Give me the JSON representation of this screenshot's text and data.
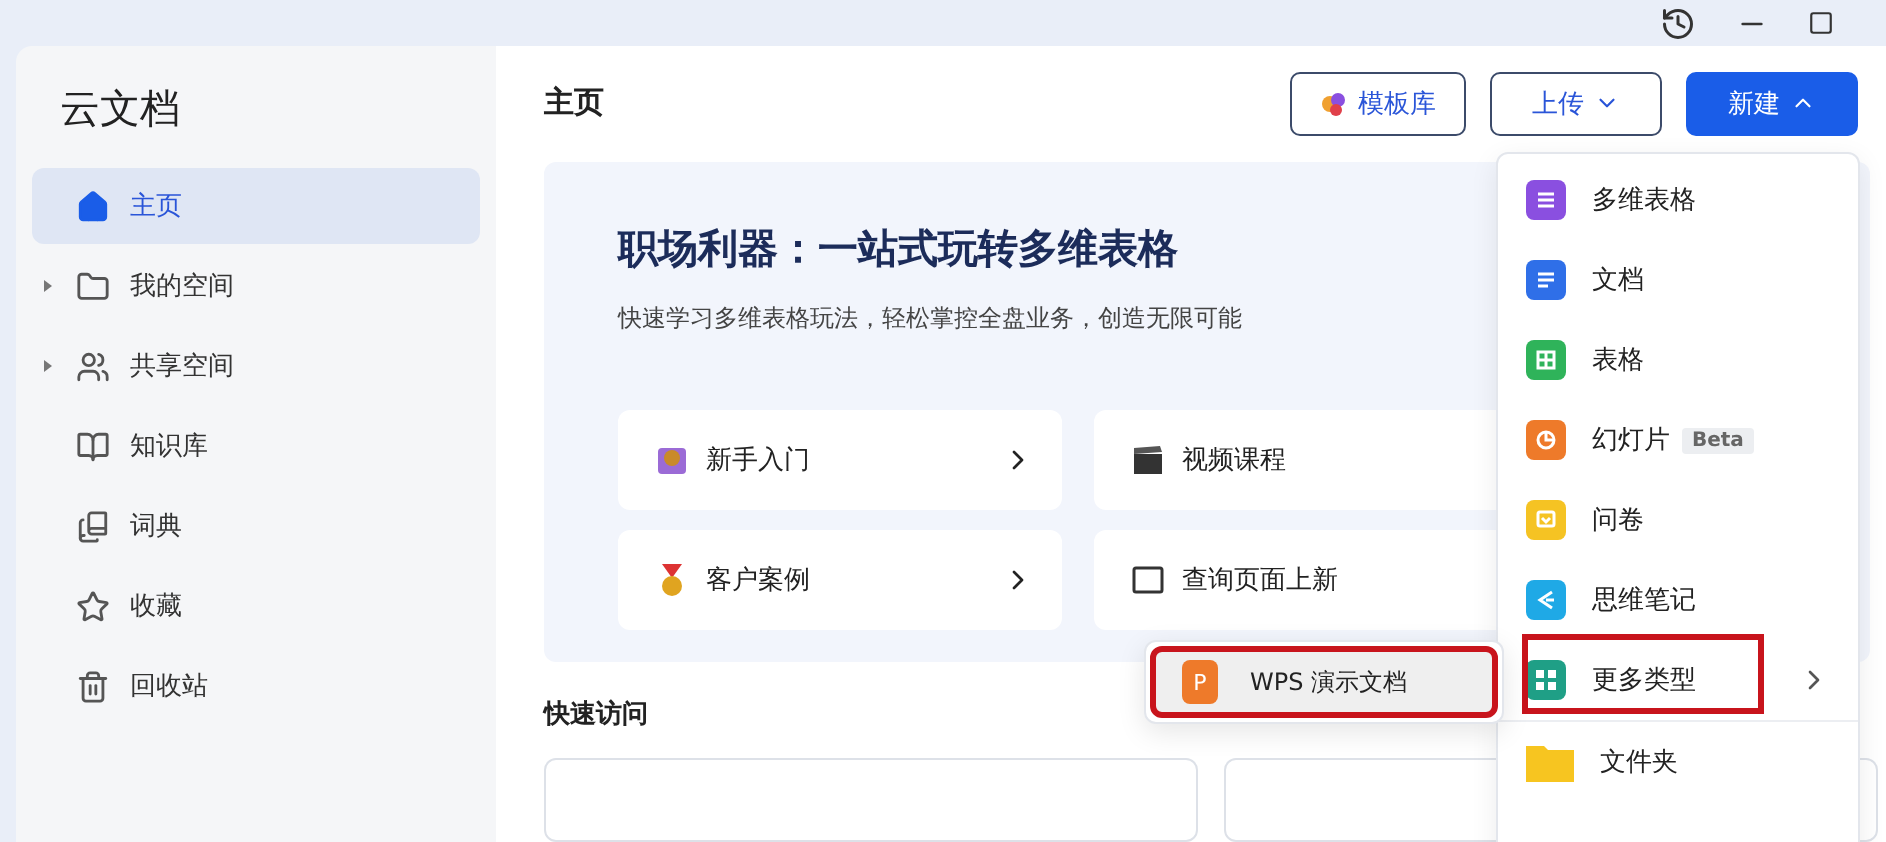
{
  "sidebar": {
    "title": "云文档",
    "items": [
      {
        "label": "主页",
        "kind": "link",
        "selected": true
      },
      {
        "label": "我的空间",
        "kind": "group",
        "selected": false
      },
      {
        "label": "共享空间",
        "kind": "group",
        "selected": false
      },
      {
        "label": "知识库",
        "kind": "link",
        "selected": false
      },
      {
        "label": "词典",
        "kind": "link",
        "selected": false
      },
      {
        "label": "收藏",
        "kind": "link",
        "selected": false
      },
      {
        "label": "回收站",
        "kind": "link",
        "selected": false
      }
    ]
  },
  "header": {
    "title": "主页",
    "buttons": [
      {
        "label": "模板库",
        "kind": "outline"
      },
      {
        "label": "上传",
        "kind": "outline-caret"
      },
      {
        "label": "新建",
        "kind": "primary"
      }
    ]
  },
  "banner": {
    "title": "职场利器：一站式玩转多维表格",
    "subtitle": "快速学习多维表格玩法，轻松掌控全盘业务，创造无限可能",
    "tiles": [
      {
        "label": "新手入门"
      },
      {
        "label": "视频课程"
      },
      {
        "label": "客户案例"
      },
      {
        "label": "查询页面上新"
      }
    ]
  },
  "quick_access": {
    "title": "快速访问"
  },
  "new_menu": {
    "items": [
      {
        "label": "多维表格",
        "color": "#8a4fe0",
        "highlighted": false
      },
      {
        "label": "文档",
        "color": "#2f6fe8",
        "highlighted": false
      },
      {
        "label": "表格",
        "color": "#2fb35a",
        "highlighted": false
      },
      {
        "label": "幻灯片",
        "badge": "Beta",
        "color": "#ee7a2a",
        "highlighted": false
      },
      {
        "label": "问卷",
        "color": "#f5c323",
        "highlighted": false
      },
      {
        "label": "思维笔记",
        "color": "#1fa9e6",
        "highlighted": false
      },
      {
        "label": "更多类型",
        "color": "#1f9f86",
        "highlighted": true,
        "submenu": true
      },
      {
        "label": "文件夹",
        "color": "#f7c520",
        "highlighted": false
      }
    ]
  },
  "submenu": {
    "items": [
      {
        "label": "WPS 演示文档",
        "icon_letter": "P",
        "color": "#ee7a2a",
        "highlighted": true,
        "hovered": true
      }
    ]
  }
}
